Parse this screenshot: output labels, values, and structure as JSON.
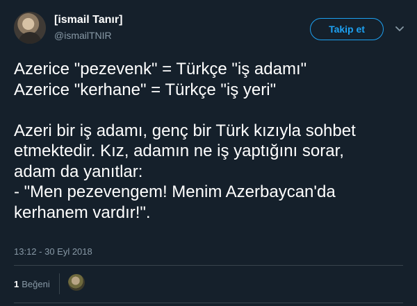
{
  "author": {
    "display_name": "[ismail Tanır]",
    "handle": "@ismailTNIR"
  },
  "actions": {
    "follow_label": "Takip et",
    "menu_icon": "chevron-down-icon"
  },
  "tweet": {
    "lines": [
      "Azerice \"pezevenk\" = Türkçe \"iş adamı\"",
      "Azerice \"kerhane\" = Türkçe \"iş yeri\"",
      "",
      "Azeri bir iş adamı, genç bir Türk kızıyla sohbet",
      "etmektedir. Kız, adamın ne iş yaptığını sorar,",
      "adam da yanıtlar:",
      "- \"Men pezevengem! Menim Azerbaycan'da",
      "kerhanem vardır!\"."
    ],
    "timestamp": "13:12 - 30 Eyl 2018"
  },
  "engagement": {
    "like_count": "1",
    "like_label": "Beğeni"
  },
  "colors": {
    "background": "#15202b",
    "accent": "#1da1f2",
    "secondary_text": "#8899a6",
    "divider": "#38444d"
  }
}
